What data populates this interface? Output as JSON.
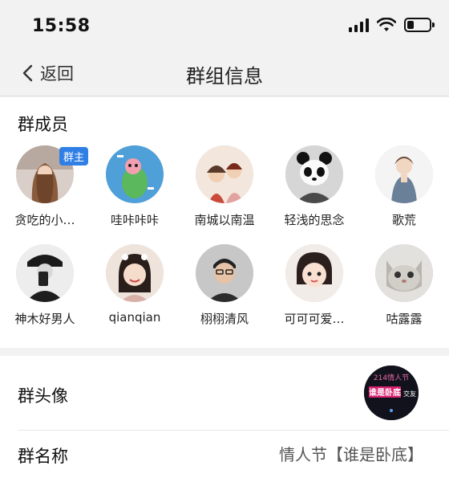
{
  "status_bar": {
    "time": "15:58",
    "battery_level": 0.25
  },
  "nav": {
    "back_label": "返回",
    "title": "群组信息"
  },
  "members_section": {
    "title": "群成员",
    "owner_badge": "群主",
    "members": [
      {
        "name": "贪吃的小…",
        "is_owner": true
      },
      {
        "name": "哇咔咔咔"
      },
      {
        "name": "南城以南温"
      },
      {
        "name": "轻浅的思念"
      },
      {
        "name": "歌荒"
      },
      {
        "name": "神木好男人"
      },
      {
        "name": "qianqian"
      },
      {
        "name": "栩栩清风"
      },
      {
        "name": "可可可爱…"
      },
      {
        "name": "咕露露"
      }
    ]
  },
  "group_info": {
    "avatar_label": "群头像",
    "avatar_image_text": {
      "line1": "214情人节",
      "line2": "谁是卧底",
      "line3": "交友"
    },
    "name_label": "群名称",
    "name_value": "情人节【谁是卧底】"
  },
  "colors": {
    "badge": "#2f7fe6",
    "background": "#f2f2f2"
  }
}
